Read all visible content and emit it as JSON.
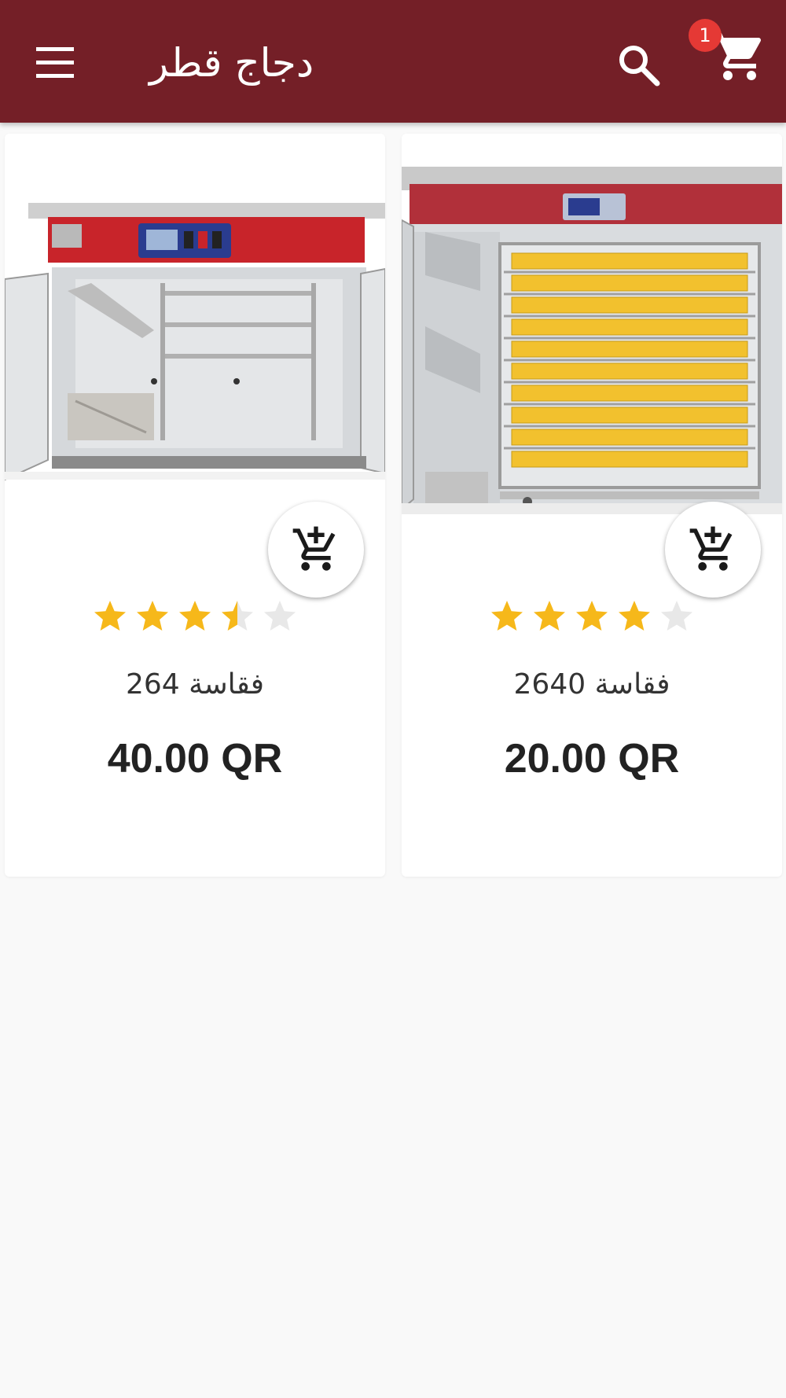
{
  "appbar": {
    "title": "دجاج قطر",
    "cart_count": "1",
    "color": "#741f27",
    "icons": {
      "menu": "menu-icon",
      "search": "search-icon",
      "cart": "shopping-cart-icon"
    }
  },
  "products": [
    {
      "name": "فقاسة 264",
      "price": "40.00 QR",
      "rating": 3.5,
      "image": "incubator-small-image"
    },
    {
      "name": "فقاسة 2640",
      "price": "20.00 QR",
      "rating": 4,
      "image": "incubator-large-image"
    }
  ],
  "colors": {
    "star_filled": "#f6b81a",
    "star_empty": "#e8e8e8",
    "badge": "#e53935"
  }
}
